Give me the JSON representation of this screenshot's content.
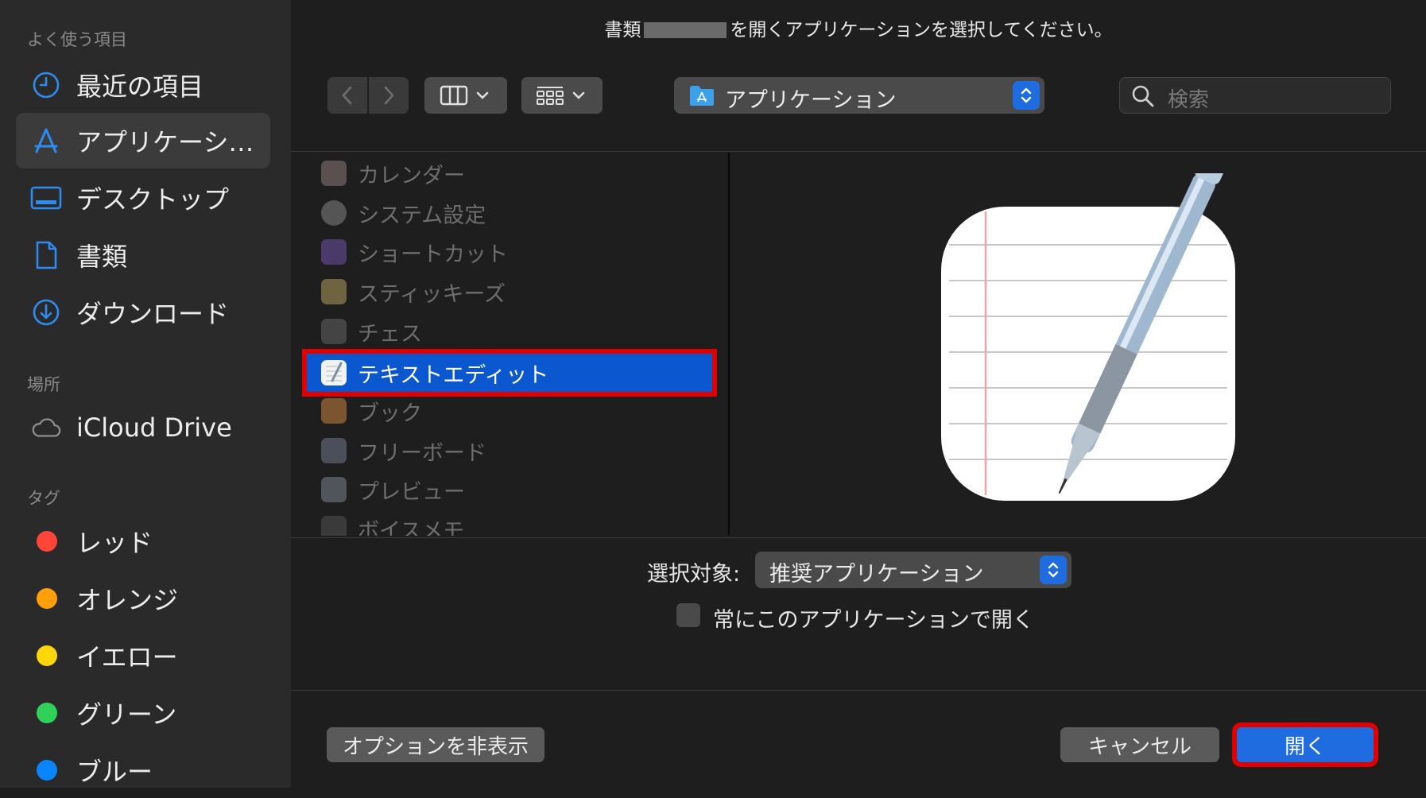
{
  "sidebar": {
    "favorites_header": "よく使う項目",
    "items": [
      {
        "label": "最近の項目",
        "icon": "clock-icon"
      },
      {
        "label": "アプリケーシ…",
        "icon": "applications-icon"
      },
      {
        "label": "デスクトップ",
        "icon": "desktop-icon"
      },
      {
        "label": "書類",
        "icon": "document-icon"
      },
      {
        "label": "ダウンロード",
        "icon": "download-icon"
      }
    ],
    "locations_header": "場所",
    "locations": [
      {
        "label": "iCloud Drive",
        "icon": "cloud-icon"
      }
    ],
    "tags_header": "タグ",
    "tags": [
      {
        "label": "レッド",
        "color": "#ff453a"
      },
      {
        "label": "オレンジ",
        "color": "#ff9f0a"
      },
      {
        "label": "イエロー",
        "color": "#ffd60a"
      },
      {
        "label": "グリーン",
        "color": "#30d158"
      },
      {
        "label": "ブルー",
        "color": "#0a84ff"
      }
    ]
  },
  "dialog": {
    "title_prefix": "書類",
    "title_suffix": "を開くアプリケーションを選択してください。"
  },
  "toolbar": {
    "path_label": "アプリケーション",
    "search_placeholder": "検索"
  },
  "apps": [
    {
      "name": "カレンダー",
      "color": "#5a5050"
    },
    {
      "name": "システム設定",
      "color": "#555555"
    },
    {
      "name": "ショートカット",
      "color": "#4a3a6a"
    },
    {
      "name": "スティッキーズ",
      "color": "#6e6440"
    },
    {
      "name": "チェス",
      "color": "#444444"
    },
    {
      "name": "テキストエディット",
      "color": "#f2f2f2",
      "selected": true
    },
    {
      "name": "ブック",
      "color": "#7a5530"
    },
    {
      "name": "フリーボード",
      "color": "#4a4f5a"
    },
    {
      "name": "プレビュー",
      "color": "#50555c"
    },
    {
      "name": "ボイスメモ",
      "color": "#3a3a3a"
    }
  ],
  "filter": {
    "label": "選択対象:",
    "value": "推奨アプリケーション"
  },
  "always_open": {
    "label": "常にこのアプリケーションで開く",
    "checked": false
  },
  "footer": {
    "options_label": "オプションを非表示",
    "cancel_label": "キャンセル",
    "open_label": "開く"
  }
}
